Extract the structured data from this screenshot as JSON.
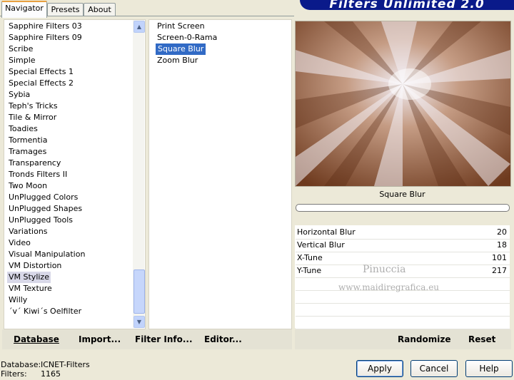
{
  "app": {
    "banner": "Filters Unlimited 2.0"
  },
  "tabs": [
    {
      "label": "Navigator"
    },
    {
      "label": "Presets"
    },
    {
      "label": "About"
    }
  ],
  "categories": [
    "Sapphire Filters 03",
    "Sapphire Filters 09",
    "Scribe",
    "Simple",
    "Special Effects 1",
    "Special Effects 2",
    "Sybia",
    "Teph's Tricks",
    "Tile & Mirror",
    "Toadies",
    "Tormentia",
    "Tramages",
    "Transparency",
    "Tronds Filters II",
    "Two Moon",
    "UnPlugged Colors",
    "UnPlugged Shapes",
    "UnPlugged Tools",
    "Variations",
    "Video",
    "Visual Manipulation",
    "VM Distortion",
    "VM Stylize",
    "VM Texture",
    "Willy",
    "´v´ Kiwi´s Oelfilter"
  ],
  "selected_category": "VM Stylize",
  "filters": [
    "Print Screen",
    "Screen-0-Rama",
    "Square Blur",
    "Zoom Blur"
  ],
  "selected_filter": "Square Blur",
  "preview": {
    "filter_name": "Square Blur"
  },
  "params": [
    {
      "label": "Horizontal Blur",
      "value": "20"
    },
    {
      "label": "Vertical Blur",
      "value": "18"
    },
    {
      "label": "X-Tune",
      "value": "101"
    },
    {
      "label": "Y-Tune",
      "value": "217"
    }
  ],
  "watermark": {
    "line1": "Pinuccia",
    "line2": "www.maidiregrafica.eu"
  },
  "bottom_bar": {
    "database": "Database",
    "import": "Import...",
    "filter_info": "Filter Info...",
    "editor": "Editor...",
    "randomize": "Randomize",
    "reset": "Reset"
  },
  "status": {
    "database_label": "Database:",
    "database_value": "ICNET-Filters",
    "filters_label": "Filters:",
    "filters_value": "1165"
  },
  "buttons": {
    "apply": "Apply",
    "cancel": "Cancel",
    "help": "Help"
  }
}
